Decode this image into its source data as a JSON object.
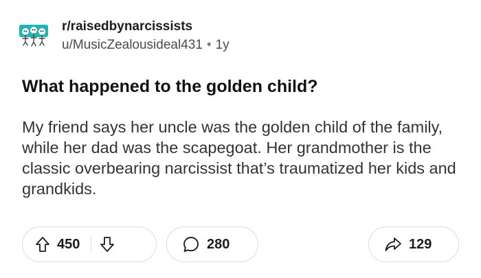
{
  "post": {
    "subreddit": "r/raisedbynarcissists",
    "author": "u/MusicZealousideal431",
    "separator": "•",
    "age": "1y",
    "title": "What happened to the golden child?",
    "body": "My friend says her uncle was the golden child of the family, while her dad was the scapegoat. Her grandmother is the classic overbearing narcissist that’s traumatized her kids and grandkids."
  },
  "actions": {
    "upvotes": "450",
    "comments": "280",
    "shares": "129"
  },
  "icons": {
    "upvote": "arrow-up-icon",
    "downvote": "arrow-down-icon",
    "comment": "speech-bubble-icon",
    "share": "share-arrow-icon"
  },
  "colors": {
    "avatar_teal": "#1fb5b5",
    "text_primary": "#1c1c1c",
    "text_secondary": "#4a4a4a",
    "border": "#d9dce0"
  }
}
